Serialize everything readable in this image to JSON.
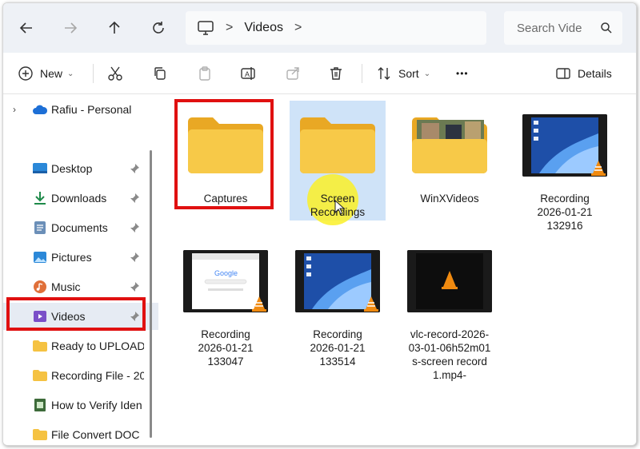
{
  "address": {
    "crumbs": [
      "Videos"
    ],
    "search_placeholder": "Search Vide"
  },
  "toolbar": {
    "new_label": "New",
    "sort_label": "Sort",
    "more_label": "•••",
    "details_label": "Details"
  },
  "sidebar": {
    "account": "Rafiu - Personal",
    "items": [
      {
        "label": "Desktop",
        "icon": "desktop-icon",
        "pinned": true
      },
      {
        "label": "Downloads",
        "icon": "downloads-icon",
        "pinned": true
      },
      {
        "label": "Documents",
        "icon": "documents-icon",
        "pinned": true
      },
      {
        "label": "Pictures",
        "icon": "pictures-icon",
        "pinned": true
      },
      {
        "label": "Music",
        "icon": "music-icon",
        "pinned": true
      },
      {
        "label": "Videos",
        "icon": "videos-icon",
        "pinned": true,
        "selected": true
      },
      {
        "label": "Ready to UPLOAD",
        "icon": "folder-icon",
        "pinned": false
      },
      {
        "label": "Recording File - 20",
        "icon": "folder-icon",
        "pinned": false
      },
      {
        "label": "How to Verify Iden",
        "icon": "file-icon",
        "pinned": false
      },
      {
        "label": "File Convert DOC",
        "icon": "folder-icon",
        "pinned": false
      }
    ]
  },
  "files": [
    {
      "name": "Captures",
      "kind": "folder",
      "highlighted": true
    },
    {
      "name": "Screen\nRecordings",
      "kind": "folder",
      "selected": true
    },
    {
      "name": "WinXVideos",
      "kind": "folder-with-preview"
    },
    {
      "name": "Recording\n2026-01-21\n132916",
      "kind": "video"
    },
    {
      "name": "Recording\n2026-01-21\n133047",
      "kind": "video"
    },
    {
      "name": "Recording\n2026-01-21\n133514",
      "kind": "video"
    },
    {
      "name": "vlc-record-2026-\n03-01-06h52m01\ns-screen record\n1.mp4-",
      "kind": "video-vlc"
    }
  ],
  "colors": {
    "highlight_box": "#e01010",
    "folder_yellow": "#f7c948",
    "selection": "#cfe3f8",
    "cursor_spot": "#faf028"
  }
}
